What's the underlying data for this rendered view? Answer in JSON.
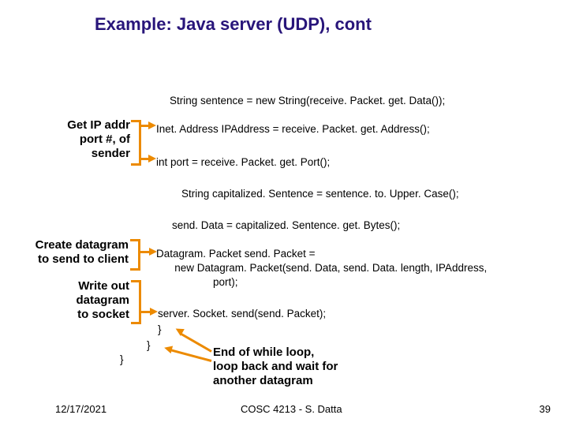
{
  "title": "Example: Java server (UDP), cont",
  "code": {
    "l1": "String sentence = new String(receive. Packet. get. Data());",
    "l2": "Inet. Address IPAddress = receive. Packet. get. Address();",
    "l3": "int port = receive. Packet. get. Port();",
    "l4": "String capitalized. Sentence = sentence. to. Upper. Case();",
    "l5": "send. Data = capitalized. Sentence. get. Bytes();",
    "l6": "Datagram. Packet send. Packet =",
    "l7": "   new Datagram. Packet(send. Data, send. Data. length, IPAddress,",
    "l8": "port);",
    "l9": "server. Socket. send(send. Packet);",
    "l10": "}",
    "l11": "}",
    "l12": "}"
  },
  "annot": {
    "a1_l1": "Get IP addr",
    "a1_l2": "port #, of",
    "a1_l3": "sender",
    "a2_l1": "Create datagram",
    "a2_l2": "to send to client",
    "a3_l1": "Write out",
    "a3_l2": "datagram",
    "a3_l3": "to socket",
    "a4_l1": "End of while loop,",
    "a4_l2": "loop back and wait for",
    "a4_l3": "another datagram"
  },
  "footer": {
    "date": "12/17/2021",
    "course": "COSC 4213 - S. Datta",
    "page": "39"
  }
}
